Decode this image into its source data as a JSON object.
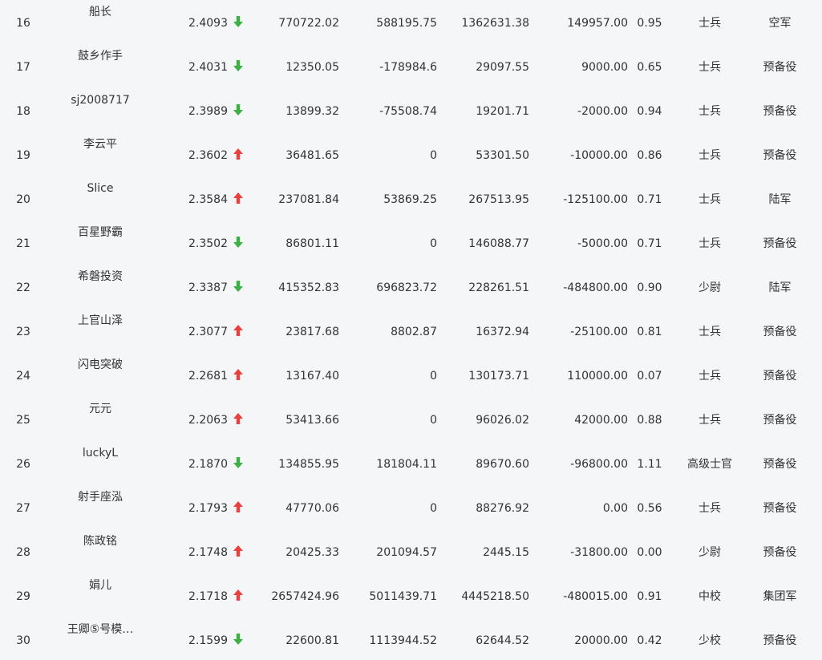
{
  "colors": {
    "up": "#e8413e",
    "down": "#3cb043",
    "text": "#333333",
    "background": "#f5f6f8"
  },
  "rows": [
    {
      "rank": "16",
      "name": "船长",
      "score": "2.4093",
      "trend": "down",
      "v1": "770722.02",
      "v2": "588195.75",
      "v3": "1362631.38",
      "v4": "149957.00",
      "ratio": "0.95",
      "title": "士兵",
      "army": "空军"
    },
    {
      "rank": "17",
      "name": "鼓乡作手",
      "score": "2.4031",
      "trend": "down",
      "v1": "12350.05",
      "v2": "-178984.6",
      "v3": "29097.55",
      "v4": "9000.00",
      "ratio": "0.65",
      "title": "士兵",
      "army": "预备役"
    },
    {
      "rank": "18",
      "name": "sj2008717",
      "score": "2.3989",
      "trend": "down",
      "v1": "13899.32",
      "v2": "-75508.74",
      "v3": "19201.71",
      "v4": "-2000.00",
      "ratio": "0.94",
      "title": "士兵",
      "army": "预备役"
    },
    {
      "rank": "19",
      "name": "李云平",
      "score": "2.3602",
      "trend": "up",
      "v1": "36481.65",
      "v2": "0",
      "v3": "53301.50",
      "v4": "-10000.00",
      "ratio": "0.86",
      "title": "士兵",
      "army": "预备役"
    },
    {
      "rank": "20",
      "name": "Slice",
      "score": "2.3584",
      "trend": "up",
      "v1": "237081.84",
      "v2": "53869.25",
      "v3": "267513.95",
      "v4": "-125100.00",
      "ratio": "0.71",
      "title": "士兵",
      "army": "陆军"
    },
    {
      "rank": "21",
      "name": "百星野霸",
      "score": "2.3502",
      "trend": "down",
      "v1": "86801.11",
      "v2": "0",
      "v3": "146088.77",
      "v4": "-5000.00",
      "ratio": "0.71",
      "title": "士兵",
      "army": "预备役"
    },
    {
      "rank": "22",
      "name": "希磐投资",
      "score": "2.3387",
      "trend": "down",
      "v1": "415352.83",
      "v2": "696823.72",
      "v3": "228261.51",
      "v4": "-484800.00",
      "ratio": "0.90",
      "title": "少尉",
      "army": "陆军"
    },
    {
      "rank": "23",
      "name": "上官山泽",
      "score": "2.3077",
      "trend": "up",
      "v1": "23817.68",
      "v2": "8802.87",
      "v3": "16372.94",
      "v4": "-25100.00",
      "ratio": "0.81",
      "title": "士兵",
      "army": "预备役"
    },
    {
      "rank": "24",
      "name": "闪电突破",
      "score": "2.2681",
      "trend": "up",
      "v1": "13167.40",
      "v2": "0",
      "v3": "130173.71",
      "v4": "110000.00",
      "ratio": "0.07",
      "title": "士兵",
      "army": "预备役"
    },
    {
      "rank": "25",
      "name": "元元",
      "score": "2.2063",
      "trend": "up",
      "v1": "53413.66",
      "v2": "0",
      "v3": "96026.02",
      "v4": "42000.00",
      "ratio": "0.88",
      "title": "士兵",
      "army": "预备役"
    },
    {
      "rank": "26",
      "name": "luckyL",
      "score": "2.1870",
      "trend": "down",
      "v1": "134855.95",
      "v2": "181804.11",
      "v3": "89670.60",
      "v4": "-96800.00",
      "ratio": "1.11",
      "title": "高级士官",
      "army": "预备役"
    },
    {
      "rank": "27",
      "name": "射手座泓",
      "score": "2.1793",
      "trend": "up",
      "v1": "47770.06",
      "v2": "0",
      "v3": "88276.92",
      "v4": "0.00",
      "ratio": "0.56",
      "title": "士兵",
      "army": "预备役"
    },
    {
      "rank": "28",
      "name": "陈政铭",
      "score": "2.1748",
      "trend": "up",
      "v1": "20425.33",
      "v2": "201094.57",
      "v3": "2445.15",
      "v4": "-31800.00",
      "ratio": "0.00",
      "title": "少尉",
      "army": "预备役"
    },
    {
      "rank": "29",
      "name": "娟儿",
      "score": "2.1718",
      "trend": "up",
      "v1": "2657424.96",
      "v2": "5011439.71",
      "v3": "4445218.50",
      "v4": "-480015.00",
      "ratio": "0.91",
      "title": "中校",
      "army": "集团军"
    },
    {
      "rank": "30",
      "name": "王卿⑤号模…",
      "score": "2.1599",
      "trend": "down",
      "v1": "22600.81",
      "v2": "1113944.52",
      "v3": "62644.52",
      "v4": "20000.00",
      "ratio": "0.42",
      "title": "少校",
      "army": "预备役"
    }
  ]
}
